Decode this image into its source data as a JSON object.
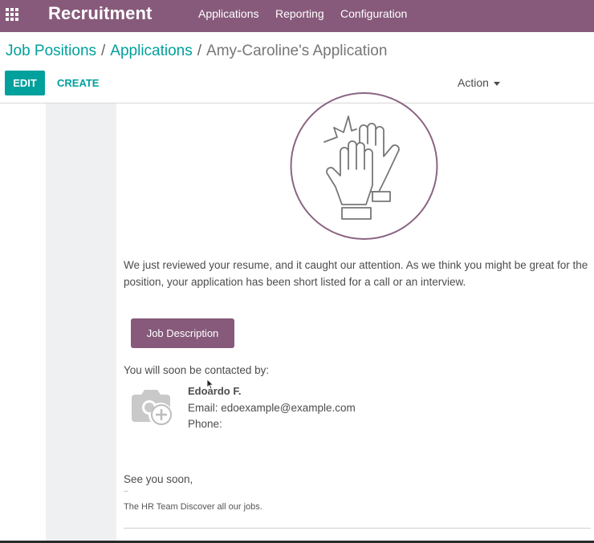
{
  "navbar": {
    "apps_icon": "grid-apps-icon",
    "app_title": "Recruitment",
    "menu": [
      "Applications",
      "Reporting",
      "Configuration"
    ],
    "color": "#875a7b"
  },
  "breadcrumb": {
    "items": [
      "Job Positions",
      "Applications"
    ],
    "separator": "/",
    "current": "Amy-Caroline's Application"
  },
  "toolbar": {
    "edit_label": "EDIT",
    "create_label": "CREATE",
    "action_label": "Action"
  },
  "content": {
    "illustration_icon": "high-five-hands-icon",
    "intro_text": "We just reviewed your resume, and it caught our attention. As we think you might be great for the position, your application has been short listed for a call or an interview.",
    "job_description_button": "Job Description",
    "contact_heading": "You will soon be contacted by:",
    "contact": {
      "avatar_icon": "camera-add-icon",
      "name": "Edoardo F.",
      "email": "Email: edoexample@example.com",
      "phone": "Phone:"
    },
    "closing": "See you soon,",
    "signature_dash": "--",
    "signature": "The HR Team Discover all our jobs."
  },
  "colors": {
    "brand": "#875a7b",
    "accent": "#00a09d"
  }
}
